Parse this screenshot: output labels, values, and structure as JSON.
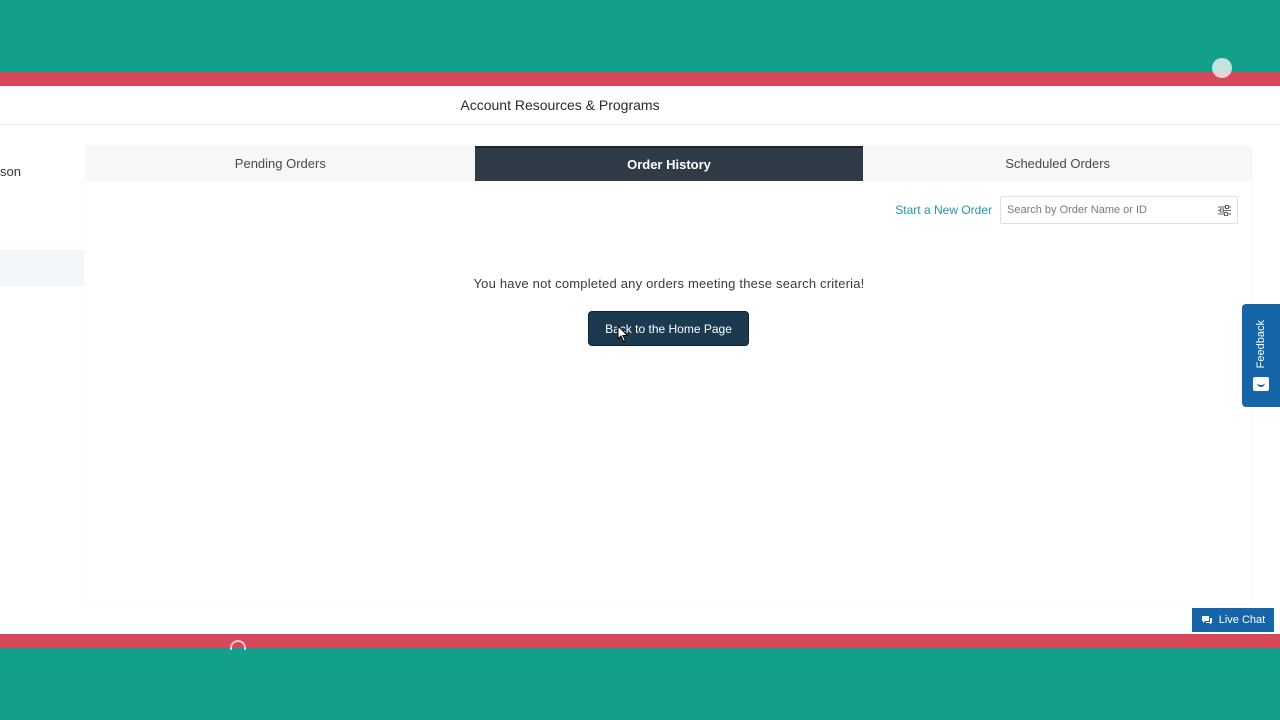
{
  "header": {
    "title": "Account Resources & Programs"
  },
  "sidebar": {
    "partial_label": "son"
  },
  "tabs": [
    {
      "label": "Pending Orders",
      "active": false
    },
    {
      "label": "Order History",
      "active": true
    },
    {
      "label": "Scheduled Orders",
      "active": false
    }
  ],
  "toolbar": {
    "new_order_label": "Start a New Order",
    "search_placeholder": "Search by Order Name or ID",
    "filter_icon": "sliders-icon"
  },
  "empty_state": {
    "message": "You have not completed any orders meeting these search criteria!",
    "button_label": "Back to the Home Page"
  },
  "feedback": {
    "label": "Feedback",
    "icon": "message-smile-icon"
  },
  "live_chat": {
    "label": "Live Chat",
    "icon": "chat-bubble-icon"
  },
  "colors": {
    "teal_background": "#12a08a",
    "red_strip": "#d6485a",
    "active_tab": "#2f3b46",
    "primary_button": "#1c3a4f",
    "link": "#2a93a8",
    "widget_blue": "#1565a8"
  }
}
